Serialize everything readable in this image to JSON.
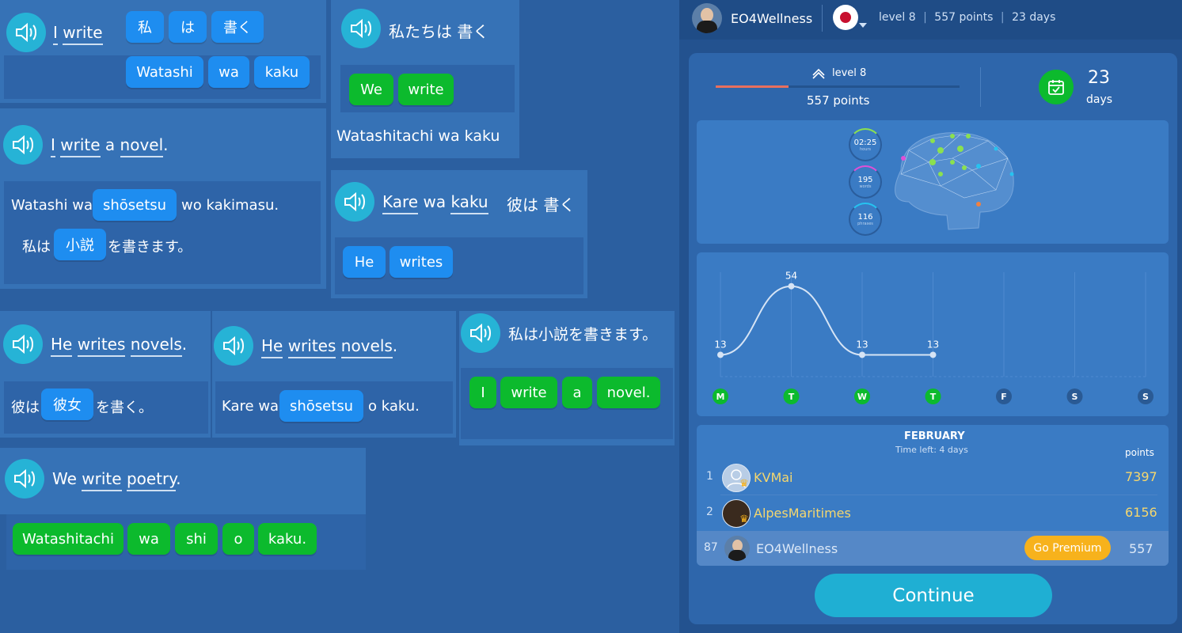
{
  "cards": {
    "c1": {
      "phrase": [
        "I",
        "write"
      ],
      "chips_top": [
        "私",
        "は",
        "書く"
      ],
      "chips_bottom": [
        "Watashi",
        "wa",
        "kaku"
      ]
    },
    "c2": {
      "phrase": "私たちは 書く",
      "chips": [
        "We",
        "write"
      ],
      "answer": "Watashitachi wa kaku"
    },
    "c3": {
      "phrase": [
        "I",
        "write",
        "a",
        "novel",
        "."
      ],
      "line1_pre": "Watashi wa",
      "line1_chip": "shōsetsu",
      "line1_post": "wo kakimasu.",
      "line2_pre": "私は",
      "line2_chip": "小説",
      "line2_post": "を書きます。"
    },
    "c4": {
      "phrase": [
        "Kare",
        "wa",
        "kaku"
      ],
      "phrase_jp": "彼は 書く",
      "chips": [
        "He",
        "writes"
      ]
    },
    "c5": {
      "phrase": [
        "He",
        "writes",
        "novels",
        "."
      ],
      "pre": "彼は",
      "chip": "彼女",
      "post": "を書く。"
    },
    "c6": {
      "phrase": [
        "He",
        "writes",
        "novels",
        "."
      ],
      "pre": "Kare wa",
      "chip": "shōsetsu",
      "post": "o kaku."
    },
    "c7": {
      "phrase": "私は小説を書きます。",
      "chips": [
        "I",
        "write",
        "a",
        "novel."
      ]
    },
    "c8": {
      "phrase": [
        "We",
        "write",
        "poetry",
        "."
      ],
      "chips": [
        "Watashitachi",
        "wa",
        "shi",
        "o",
        "kaku."
      ]
    }
  },
  "header": {
    "username": "EO4Wellness",
    "level": "level 8",
    "points": "557 points",
    "days": "23 days"
  },
  "stats": {
    "level_label": "level 8",
    "points_label": "557 points",
    "progress": 0.3,
    "days_value": "23",
    "days_label": "days"
  },
  "brain": {
    "rings": [
      {
        "value": "02:25",
        "unit": "hours"
      },
      {
        "value": "195",
        "unit": "words"
      },
      {
        "value": "116",
        "unit": "phrases"
      }
    ]
  },
  "chart_data": {
    "type": "line",
    "categories": [
      "M",
      "T",
      "W",
      "T",
      "F",
      "S",
      "S"
    ],
    "values": [
      13,
      54,
      13,
      13,
      null,
      null,
      null
    ],
    "data_labels": [
      "13",
      "54",
      "13",
      "13"
    ],
    "active_days": [
      true,
      true,
      true,
      true,
      false,
      false,
      false
    ],
    "ylim": [
      0,
      60
    ],
    "grid": true
  },
  "leaderboard": {
    "month": "FEBRUARY",
    "time_left": "Time left: 4 days",
    "points_header": "points",
    "rows": [
      {
        "rank": "1",
        "name": "KVMai",
        "points": "7397"
      },
      {
        "rank": "2",
        "name": "AlpesMaritimes",
        "points": "6156"
      },
      {
        "rank": "87",
        "name": "EO4Wellness",
        "points": "557"
      }
    ],
    "premium_label": "Go Premium"
  },
  "continue_label": "Continue",
  "colors": {
    "blue_chip": "#1e8df0",
    "green_chip": "#0cba2d",
    "speaker": "#26b3d6",
    "premium": "#f7b21c",
    "continue": "#1fafd3"
  }
}
